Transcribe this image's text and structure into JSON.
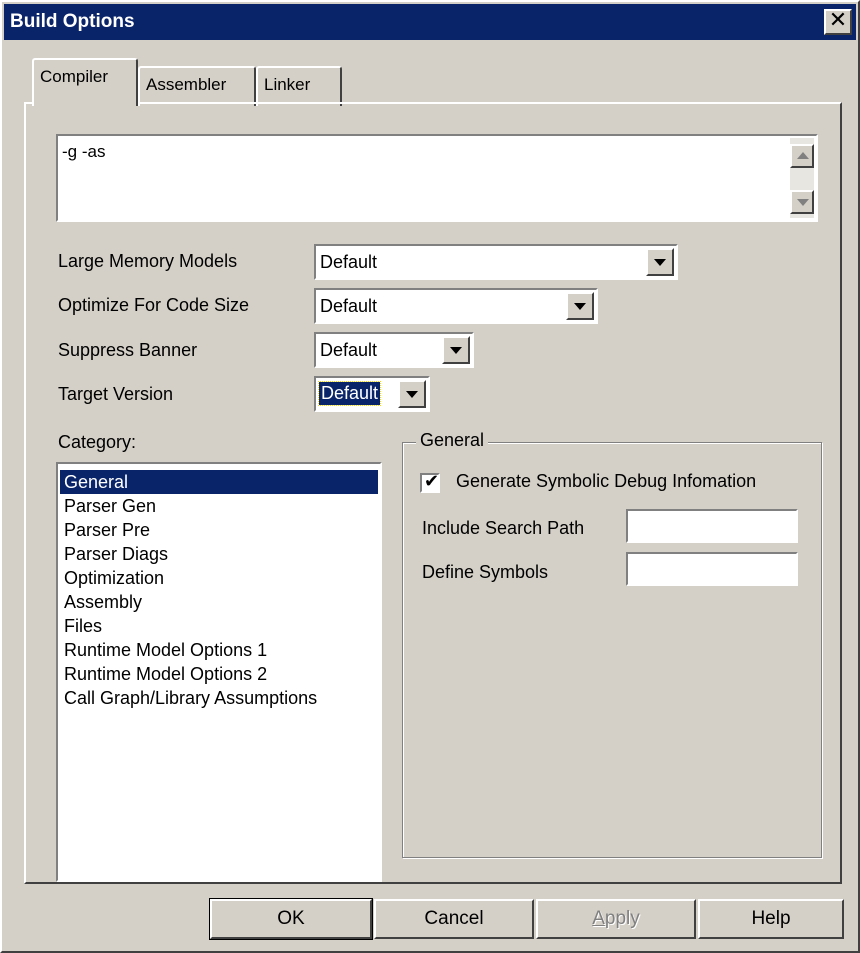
{
  "window": {
    "title": "Build Options",
    "close_glyph": "✕"
  },
  "tabs": [
    {
      "label": "Compiler",
      "active": true
    },
    {
      "label": "Assembler",
      "active": false
    },
    {
      "label": "Linker",
      "active": false
    }
  ],
  "options_text": "-g -as",
  "settings": {
    "large_memory_models": {
      "label": "Large Memory Models",
      "value": "Default"
    },
    "optimize_code_size": {
      "label": "Optimize For Code Size",
      "value": "Default"
    },
    "suppress_banner": {
      "label": "Suppress Banner",
      "value": "Default"
    },
    "target_version": {
      "label": "Target Version",
      "value": "Default"
    }
  },
  "category": {
    "label": "Category:",
    "items": [
      "General",
      "Parser Gen",
      "Parser Pre",
      "Parser Diags",
      "Optimization",
      "Assembly",
      "Files",
      "Runtime Model Options 1",
      "Runtime Model Options 2",
      "Call Graph/Library Assumptions"
    ],
    "selected": "General"
  },
  "general_group": {
    "title": "General",
    "debug_checkbox": {
      "label": "Generate Symbolic Debug Infomation",
      "checked": true,
      "check_glyph": "✔"
    },
    "include_search_path": {
      "label": "Include Search Path",
      "value": ""
    },
    "define_symbols": {
      "label": "Define Symbols",
      "value": ""
    }
  },
  "buttons": {
    "ok": "OK",
    "cancel": "Cancel",
    "apply_mnemonic": "A",
    "apply_rest": "pply",
    "help": "Help"
  },
  "colors": {
    "title_bar": "#0a246a",
    "face": "#d4d0c8",
    "selection": "#0a246a"
  }
}
